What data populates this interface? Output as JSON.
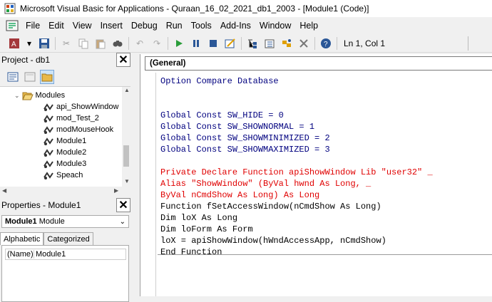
{
  "window": {
    "title": "Microsoft Visual Basic for Applications - Quraan_16_02_2021_db1_2003 - [Module1 (Code)]"
  },
  "menu": [
    "File",
    "Edit",
    "View",
    "Insert",
    "Debug",
    "Run",
    "Tools",
    "Add-Ins",
    "Window",
    "Help"
  ],
  "toolbar": {
    "position": "Ln 1, Col 1"
  },
  "project": {
    "header": "Project - db1",
    "folder": "Modules",
    "items": [
      "api_ShowWindow",
      "mod_Test_2",
      "modMouseHook",
      "Module1",
      "Module2",
      "Module3",
      "Speach"
    ]
  },
  "properties": {
    "header": "Properties - Module1",
    "object_bold": "Module1",
    "object_type": "Module",
    "tabs": [
      "Alphabetic",
      "Categorized"
    ],
    "row_key": "(Name)",
    "row_value": "Module1"
  },
  "code": {
    "object_combo": "(General)",
    "lines": [
      {
        "text": "Option Compare Database",
        "color": "#00007f"
      },
      {
        "text": "",
        "color": "#000"
      },
      {
        "text": "",
        "color": "#000"
      },
      {
        "text": "Global Const SW_HIDE = 0",
        "color": "#00007f"
      },
      {
        "text": "Global Const SW_SHOWNORMAL = 1",
        "color": "#00007f"
      },
      {
        "text": "Global Const SW_SHOWMINIMIZED = 2",
        "color": "#00007f"
      },
      {
        "text": "Global Const SW_SHOWMAXIMIZED = 3",
        "color": "#00007f"
      },
      {
        "text": "",
        "color": "#000"
      },
      {
        "text": "Private Declare Function apiShowWindow Lib \"user32\" _",
        "color": "#e00000"
      },
      {
        "text": "Alias \"ShowWindow\" (ByVal hwnd As Long, _",
        "color": "#e00000"
      },
      {
        "text": "ByVal nCmdShow As Long) As Long",
        "color": "#e00000"
      },
      {
        "text": "Function fSetAccessWindow(nCmdShow As Long)",
        "color": "#000"
      },
      {
        "text": "Dim loX As Long",
        "color": "#000"
      },
      {
        "text": "Dim loForm As Form",
        "color": "#000"
      },
      {
        "text": "loX = apiShowWindow(hWndAccessApp, nCmdShow)",
        "color": "#000"
      },
      {
        "text": "End Function",
        "color": "#000"
      }
    ]
  }
}
